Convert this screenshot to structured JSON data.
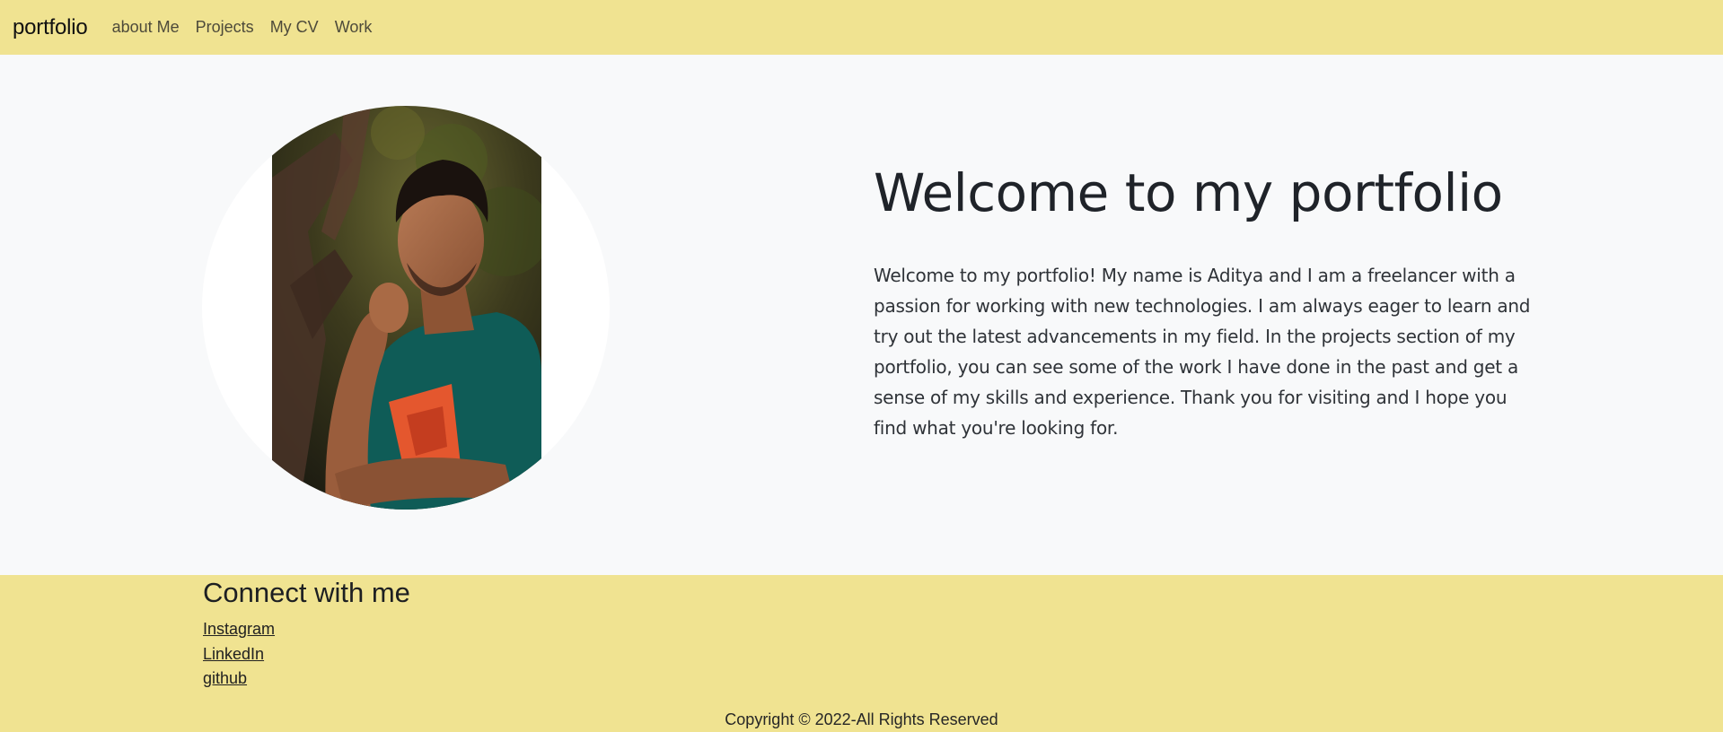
{
  "navbar": {
    "brand": "portfolio",
    "links": [
      "about Me",
      "Projects",
      "My CV",
      "Work"
    ]
  },
  "hero": {
    "title": "Welcome to my portfolio",
    "text": "Welcome to my portfolio! My name is Aditya and I am a freelancer with a passion for working with new technologies. I am always eager to learn and try out the latest advancements in my field. In the projects section of my portfolio, you can see some of the work I have done in the past and get a sense of my skills and experience. Thank you for visiting and I hope you find what you're looking for.",
    "photo_icon": "profile-photo"
  },
  "footer": {
    "connect_title": "Connect with me",
    "links": [
      "Instagram",
      "LinkedIn",
      "github"
    ],
    "copyright": "Copyright © 2022-All Rights Reserved"
  },
  "colors": {
    "navbar_bg": "#f0e391",
    "footer_bg": "#f0e391",
    "hero_bg": "#f8f9fa",
    "text_dark": "#212529"
  }
}
